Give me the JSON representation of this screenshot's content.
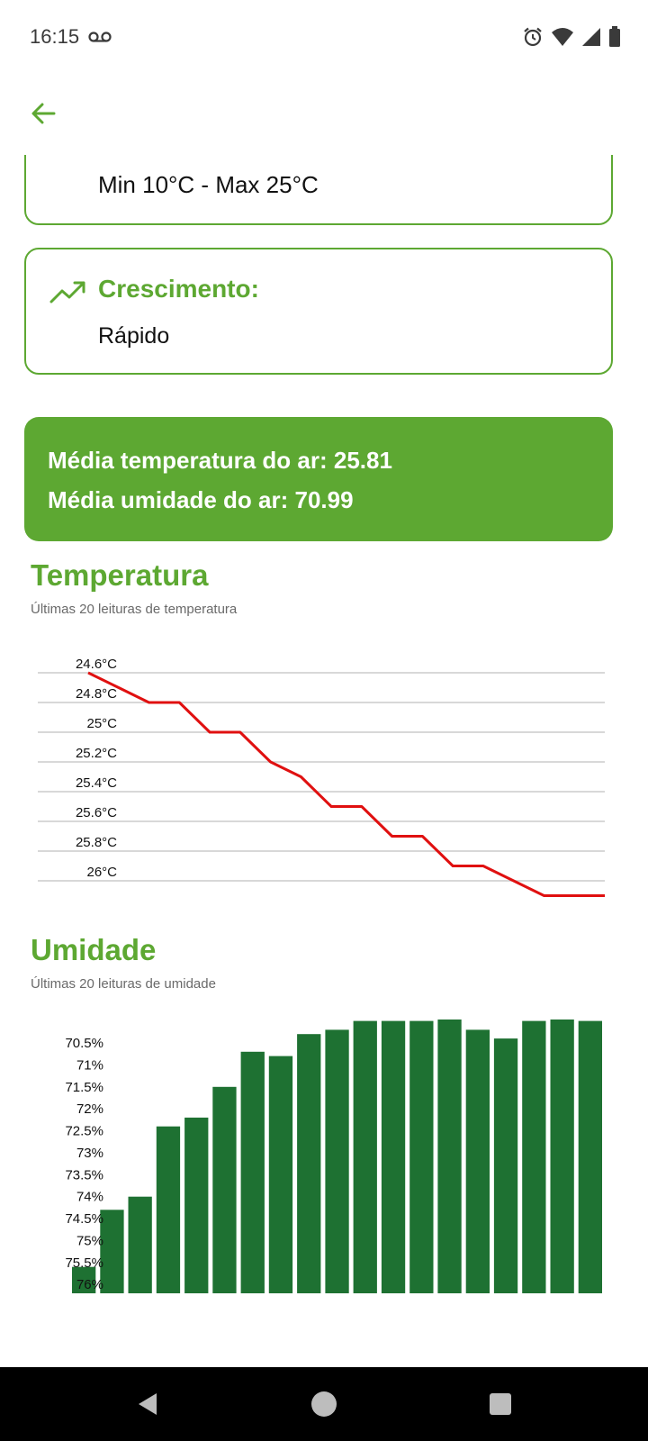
{
  "status": {
    "time": "16:15",
    "icons": [
      "voicemail-icon",
      "alarm-icon",
      "wifi-icon",
      "signal-icon",
      "battery-icon"
    ]
  },
  "header": {
    "back_icon": "arrow-left-icon"
  },
  "temperature_card": {
    "value": "Min 10°C - Max 25°C"
  },
  "growth_card": {
    "icon": "trending-up-icon",
    "title": "Crescimento:",
    "value": "Rápido"
  },
  "summary": {
    "air_temp_avg": "Média temperatura do ar: 25.81",
    "air_humidity_avg": "Média umidade do ar: 70.99"
  },
  "temperature_section": {
    "title": "Temperatura",
    "subtitle": "Últimas 20 leituras de temperatura"
  },
  "humidity_section": {
    "title": "Umidade",
    "subtitle": "Últimas 20 leituras de umidade"
  },
  "colors": {
    "accent": "#5da832",
    "line": "#e01010",
    "bar": "#1e7132",
    "grid": "#cccccc"
  },
  "chart_data": [
    {
      "type": "line",
      "ylim": [
        24.6,
        26.1
      ],
      "y_inverted": true,
      "y_ticks": [
        24.6,
        24.8,
        25,
        25.2,
        25.4,
        25.6,
        25.8,
        26
      ],
      "y_tick_labels": [
        "24.6°C",
        "24.8°C",
        "25°C",
        "25.2°C",
        "25.4°C",
        "25.6°C",
        "25.8°C",
        "26°C"
      ],
      "grid": true,
      "values": [
        24.6,
        24.7,
        24.8,
        24.8,
        25.0,
        25.0,
        25.2,
        25.3,
        25.5,
        25.5,
        25.7,
        25.7,
        25.9,
        25.9,
        26.0,
        26.1,
        26.1,
        26.1
      ]
    },
    {
      "type": "bar",
      "ylim": [
        70.5,
        76.2
      ],
      "y_inverted": true,
      "y_ticks": [
        70.5,
        71,
        71.5,
        72,
        72.5,
        73,
        73.5,
        74,
        74.5,
        75,
        75.5,
        76
      ],
      "y_tick_labels": [
        "70.5%",
        "71%",
        "71.5%",
        "72%",
        "72.5%",
        "73%",
        "73.5%",
        "74%",
        "74.5%",
        "75%",
        "75.5%",
        "76%"
      ],
      "grid": false,
      "values": [
        75.6,
        74.3,
        74.0,
        72.4,
        72.2,
        71.5,
        70.7,
        70.8,
        70.3,
        70.2,
        70.0,
        70.0,
        70.0,
        69.8,
        70.2,
        70.4,
        70.0,
        69.9,
        70.0
      ]
    }
  ]
}
